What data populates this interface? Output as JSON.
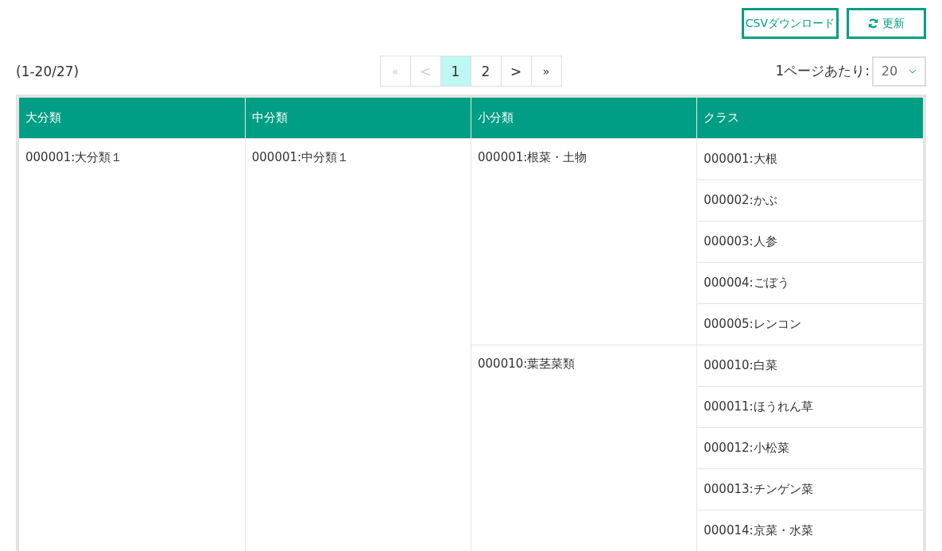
{
  "toolbar": {
    "csv_button": "CSVダウンロード",
    "refresh_button": "更新"
  },
  "range_text": "(1-20/27)",
  "pagination": [
    {
      "label": "«",
      "kind": "first",
      "disabled": true,
      "selected": false
    },
    {
      "label": "<",
      "kind": "prev",
      "disabled": true,
      "selected": false
    },
    {
      "label": "1",
      "kind": "page",
      "disabled": false,
      "selected": true
    },
    {
      "label": "2",
      "kind": "page",
      "disabled": false,
      "selected": false
    },
    {
      "label": ">",
      "kind": "next",
      "disabled": false,
      "selected": false
    },
    {
      "label": "»",
      "kind": "last",
      "disabled": false,
      "selected": false
    }
  ],
  "per_page": {
    "label": "1ページあたり:",
    "value": "20"
  },
  "table": {
    "columns": [
      "大分類",
      "中分類",
      "小分類",
      "クラス"
    ],
    "groups": [
      {
        "label": "000001:大分類１",
        "children": [
          {
            "label": "000001:中分類１",
            "children": [
              {
                "label": "000001:根菜・土物",
                "children": [
                  "000001:大根",
                  "000002:かぶ",
                  "000003:人参",
                  "000004:ごぼう",
                  "000005:レンコン"
                ]
              },
              {
                "label": "000010:葉茎菜類",
                "children": [
                  "000010:白菜",
                  "000011:ほうれん草",
                  "000012:小松菜",
                  "000013:チンゲン菜",
                  "000014:京菜・水菜"
                ]
              }
            ]
          }
        ]
      }
    ]
  }
}
